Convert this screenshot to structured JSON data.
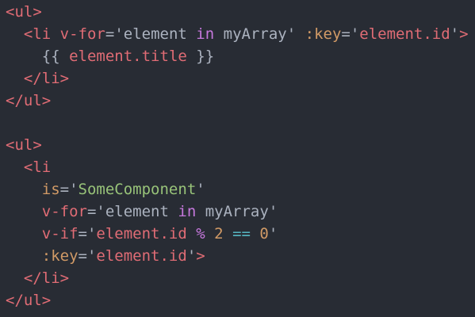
{
  "colors": {
    "background": "#282c34",
    "default": "#abb2bf",
    "tag": "#e06c75",
    "attr": "#d19a66",
    "string_green": "#98c379",
    "keyword": "#c678dd",
    "operator": "#56b6c2"
  },
  "code": {
    "lines": [
      {
        "tokens": [
          {
            "t": "<ul>",
            "c": "tag"
          }
        ]
      },
      {
        "tokens": [
          {
            "t": "  "
          },
          {
            "t": "<li",
            "c": "tag"
          },
          {
            "t": " "
          },
          {
            "t": "v-for",
            "c": "tag"
          },
          {
            "t": "='"
          },
          {
            "t": "element"
          },
          {
            "t": " "
          },
          {
            "t": "in",
            "c": "keyword"
          },
          {
            "t": " "
          },
          {
            "t": "myArray"
          },
          {
            "t": "'"
          },
          {
            "t": " "
          },
          {
            "t": ":key",
            "c": "attr"
          },
          {
            "t": "='"
          },
          {
            "t": "element.id",
            "c": "tag"
          },
          {
            "t": "'"
          },
          {
            "t": ">",
            "c": "tag"
          }
        ]
      },
      {
        "tokens": [
          {
            "t": "    "
          },
          {
            "t": "{{"
          },
          {
            "t": " "
          },
          {
            "t": "element.title",
            "c": "tag"
          },
          {
            "t": " "
          },
          {
            "t": "}}"
          }
        ]
      },
      {
        "tokens": [
          {
            "t": "  "
          },
          {
            "t": "</li>",
            "c": "tag"
          }
        ]
      },
      {
        "tokens": [
          {
            "t": "</ul>",
            "c": "tag"
          }
        ]
      },
      {
        "tokens": [
          {
            "t": ""
          }
        ]
      },
      {
        "tokens": [
          {
            "t": "<ul>",
            "c": "tag"
          }
        ]
      },
      {
        "tokens": [
          {
            "t": "  "
          },
          {
            "t": "<li",
            "c": "tag"
          }
        ]
      },
      {
        "tokens": [
          {
            "t": "    "
          },
          {
            "t": "is",
            "c": "attr"
          },
          {
            "t": "='"
          },
          {
            "t": "SomeComponent",
            "c": "string_green"
          },
          {
            "t": "'"
          }
        ]
      },
      {
        "tokens": [
          {
            "t": "    "
          },
          {
            "t": "v-for",
            "c": "tag"
          },
          {
            "t": "='"
          },
          {
            "t": "element"
          },
          {
            "t": " "
          },
          {
            "t": "in",
            "c": "keyword"
          },
          {
            "t": " "
          },
          {
            "t": "myArray"
          },
          {
            "t": "'"
          }
        ]
      },
      {
        "tokens": [
          {
            "t": "    "
          },
          {
            "t": "v-if",
            "c": "tag"
          },
          {
            "t": "='"
          },
          {
            "t": "element.id",
            "c": "tag"
          },
          {
            "t": " "
          },
          {
            "t": "%",
            "c": "keyword"
          },
          {
            "t": " "
          },
          {
            "t": "2",
            "c": "attr"
          },
          {
            "t": " "
          },
          {
            "t": "==",
            "c": "operator"
          },
          {
            "t": " "
          },
          {
            "t": "0",
            "c": "attr"
          },
          {
            "t": "'"
          }
        ]
      },
      {
        "tokens": [
          {
            "t": "    "
          },
          {
            "t": ":key",
            "c": "attr"
          },
          {
            "t": "='"
          },
          {
            "t": "element.id",
            "c": "tag"
          },
          {
            "t": "'"
          },
          {
            "t": ">",
            "c": "tag"
          }
        ]
      },
      {
        "tokens": [
          {
            "t": "  "
          },
          {
            "t": "</li>",
            "c": "tag"
          }
        ]
      },
      {
        "tokens": [
          {
            "t": "</ul>",
            "c": "tag"
          }
        ]
      }
    ]
  }
}
